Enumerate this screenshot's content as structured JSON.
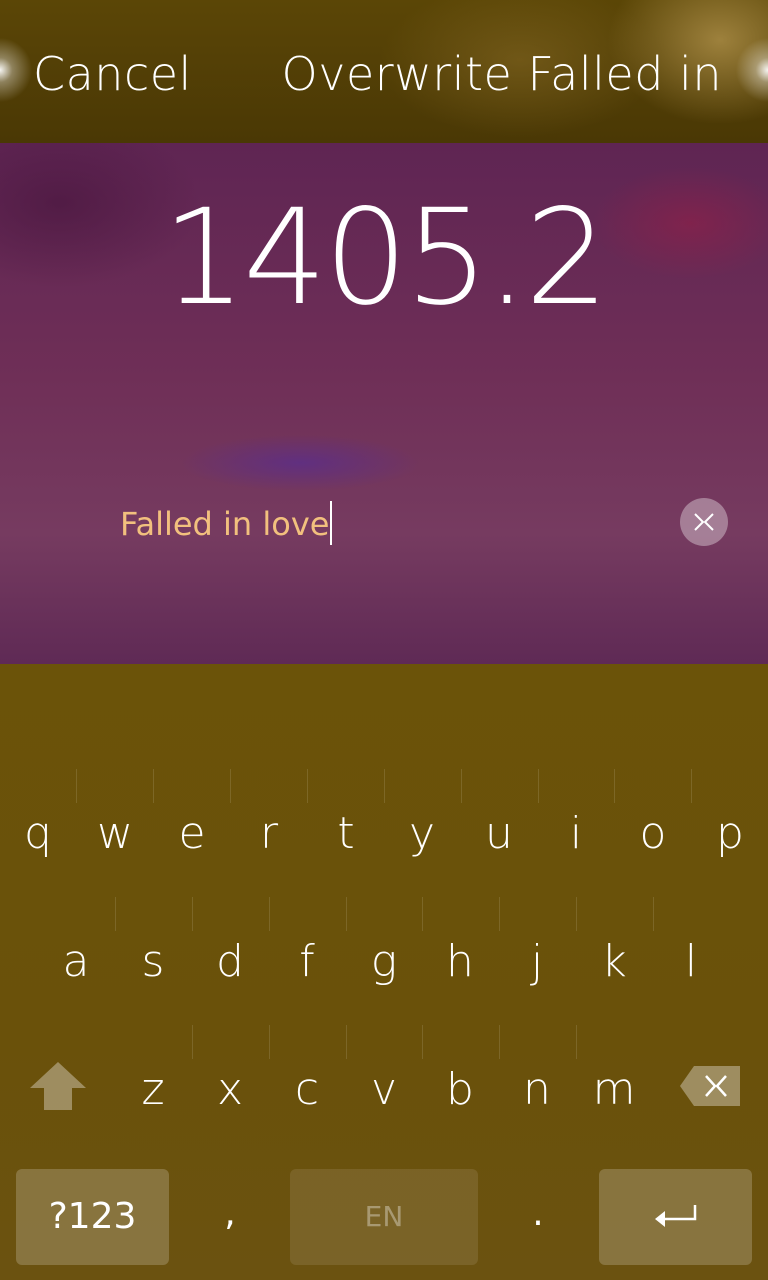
{
  "header": {
    "cancel_label": "Cancel",
    "accept_label": "Overwrite Falled in"
  },
  "dialog": {
    "value": "1405.2",
    "field_text": "Falled in love"
  },
  "keyboard": {
    "row1": [
      "q",
      "w",
      "e",
      "r",
      "t",
      "y",
      "u",
      "i",
      "o",
      "p"
    ],
    "row2": [
      "a",
      "s",
      "d",
      "f",
      "g",
      "h",
      "j",
      "k",
      "l"
    ],
    "row3": [
      "z",
      "x",
      "c",
      "v",
      "b",
      "n",
      "m"
    ],
    "symbols_label": "?123",
    "comma_label": ",",
    "language_label": "EN",
    "period_label": ".",
    "icons": {
      "shift": "shift-arrow-icon",
      "backspace": "backspace-icon",
      "enter": "enter-return-icon",
      "clear": "clear-text-icon"
    }
  },
  "colors": {
    "accent": "#f2c07e",
    "header_bg": "#4f3b05",
    "dialog_bg": "#6f2f57",
    "keyboard_bg": "#6a510a"
  }
}
